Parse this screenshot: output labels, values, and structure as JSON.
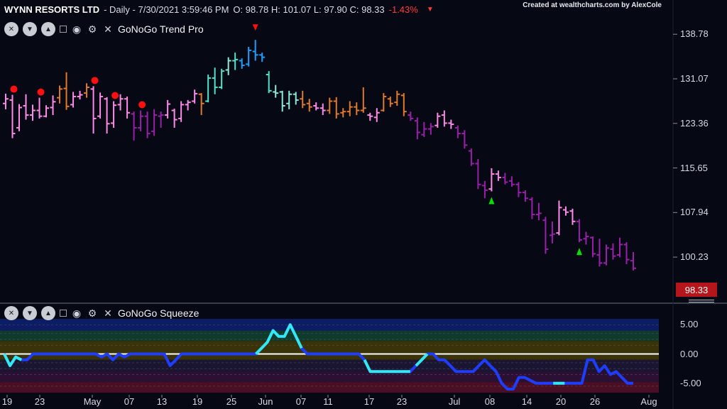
{
  "header": {
    "symbol": "WYNN RESORTS LTD",
    "info": " - Daily - 7/30/2021 3:59:46 PM",
    "ohlc": "O: 98.78 H: 101.07 L: 97.90 C: 98.33",
    "change": "-1.43%",
    "change_icon": "triangle-down-icon"
  },
  "credit": "Created at wealthcharts.com by AlexCole",
  "colors": {
    "background": "#060914",
    "strong_up": "#1e9fff",
    "up": "#4fe3c9",
    "weak_up": "#8fe9d8",
    "neutral": "#e07a2a",
    "weak_down": "#ff8ae6",
    "down": "#9a1faa",
    "strong_down": "#7b0f8a",
    "squeeze_line": "#1e3dff",
    "squeeze_max": "#33e8f0",
    "zero_line": "#ffffff",
    "last_price": "#b5161b",
    "dot": "#ff1010",
    "arrow_up": "#00e000",
    "arrow_down": "#ff1010"
  },
  "panels": {
    "price": {
      "name": "GoNoGo Trend Pro"
    },
    "squeeze": {
      "name": "GoNoGo Squeeze"
    }
  },
  "toolbar_icons": [
    "close-circle-icon",
    "triangle-down-icon",
    "triangle-up-icon",
    "collapse-box-icon",
    "eye-icon",
    "gear-icon",
    "close-icon"
  ],
  "last_price": "98.33",
  "chart_data": [
    {
      "type": "ohlc",
      "title": "WYNN RESORTS LTD",
      "y_ticks": [
        138.78,
        131.07,
        123.36,
        115.65,
        107.94,
        100.23
      ],
      "x_ticks": [
        "19",
        "23",
        "May",
        "07",
        "13",
        "19",
        "25",
        "Jun",
        "07",
        "11",
        "17",
        "23",
        "Jul",
        "08",
        "14",
        "20",
        "26",
        "Aug"
      ],
      "y_range": [
        92.5,
        142
      ],
      "bars": [
        {
          "o": 126.8,
          "h": 128.5,
          "l": 125.8,
          "c": 127.6,
          "s": "weak_down"
        },
        {
          "o": 127.4,
          "h": 128.3,
          "l": 120.8,
          "c": 121.6,
          "s": "weak_down"
        },
        {
          "o": 122.6,
          "h": 126.7,
          "l": 122.0,
          "c": 126.1,
          "s": "weak_down"
        },
        {
          "o": 126.4,
          "h": 128.4,
          "l": 124.0,
          "c": 124.8,
          "s": "weak_down"
        },
        {
          "o": 124.8,
          "h": 126.6,
          "l": 123.8,
          "c": 125.6,
          "s": "weak_down"
        },
        {
          "o": 125.6,
          "h": 127.8,
          "l": 124.2,
          "c": 124.6,
          "s": "weak_down"
        },
        {
          "o": 124.6,
          "h": 126.5,
          "l": 124.4,
          "c": 126.0,
          "s": "weak_down"
        },
        {
          "o": 126.1,
          "h": 128.2,
          "l": 124.8,
          "c": 127.1,
          "s": "weak_down"
        },
        {
          "o": 127.8,
          "h": 129.9,
          "l": 126.8,
          "c": 129.3,
          "s": "neutral"
        },
        {
          "o": 129.4,
          "h": 132.2,
          "l": 125.7,
          "c": 126.3,
          "s": "neutral"
        },
        {
          "o": 126.6,
          "h": 128.8,
          "l": 126.1,
          "c": 128.0,
          "s": "weak_down"
        },
        {
          "o": 128.0,
          "h": 129.0,
          "l": 127.5,
          "c": 128.3,
          "s": "weak_down"
        },
        {
          "o": 128.6,
          "h": 130.3,
          "l": 127.8,
          "c": 129.6,
          "s": "neutral"
        },
        {
          "o": 129.3,
          "h": 129.8,
          "l": 121.6,
          "c": 124.2,
          "s": "weak_down"
        },
        {
          "o": 124.6,
          "h": 128.7,
          "l": 124.2,
          "c": 128.0,
          "s": "weak_down"
        },
        {
          "o": 127.6,
          "h": 127.9,
          "l": 121.6,
          "c": 123.3,
          "s": "weak_down"
        },
        {
          "o": 123.4,
          "h": 127.2,
          "l": 122.6,
          "c": 126.5,
          "s": "weak_down"
        },
        {
          "o": 126.6,
          "h": 128.4,
          "l": 125.6,
          "c": 127.6,
          "s": "weak_down"
        },
        {
          "o": 127.6,
          "h": 128.0,
          "l": 124.2,
          "c": 125.2,
          "s": "weak_down"
        },
        {
          "o": 125.0,
          "h": 125.4,
          "l": 120.4,
          "c": 122.6,
          "s": "down"
        },
        {
          "o": 122.6,
          "h": 125.6,
          "l": 122.0,
          "c": 124.6,
          "s": "down"
        },
        {
          "o": 124.6,
          "h": 125.4,
          "l": 120.8,
          "c": 121.6,
          "s": "down"
        },
        {
          "o": 122.0,
          "h": 125.8,
          "l": 121.2,
          "c": 124.8,
          "s": "down"
        },
        {
          "o": 124.6,
          "h": 125.4,
          "l": 122.6,
          "c": 124.8,
          "s": "down"
        },
        {
          "o": 124.8,
          "h": 127.4,
          "l": 124.2,
          "c": 126.7,
          "s": "weak_down"
        },
        {
          "o": 125.6,
          "h": 125.9,
          "l": 122.6,
          "c": 124.0,
          "s": "weak_down"
        },
        {
          "o": 124.2,
          "h": 127.2,
          "l": 123.6,
          "c": 126.6,
          "s": "weak_down"
        },
        {
          "o": 126.6,
          "h": 127.4,
          "l": 125.6,
          "c": 127.0,
          "s": "weak_down"
        },
        {
          "o": 127.2,
          "h": 129.2,
          "l": 126.8,
          "c": 128.5,
          "s": "weak_down"
        },
        {
          "o": 128.4,
          "h": 128.6,
          "l": 124.8,
          "c": 126.8,
          "s": "neutral"
        },
        {
          "o": 127.2,
          "h": 131.8,
          "l": 127.0,
          "c": 131.2,
          "s": "up"
        },
        {
          "o": 131.2,
          "h": 133.0,
          "l": 128.4,
          "c": 129.6,
          "s": "up"
        },
        {
          "o": 129.6,
          "h": 132.8,
          "l": 129.3,
          "c": 132.4,
          "s": "up"
        },
        {
          "o": 132.6,
          "h": 134.8,
          "l": 131.7,
          "c": 134.2,
          "s": "weak_up"
        },
        {
          "o": 134.2,
          "h": 135.6,
          "l": 132.6,
          "c": 134.4,
          "s": "up"
        },
        {
          "o": 134.2,
          "h": 134.6,
          "l": 132.8,
          "c": 133.4,
          "s": "strong_up"
        },
        {
          "o": 133.6,
          "h": 136.6,
          "l": 133.2,
          "c": 136.0,
          "s": "strong_up"
        },
        {
          "o": 135.8,
          "h": 137.8,
          "l": 134.2,
          "c": 135.2,
          "s": "strong_up"
        },
        {
          "o": 135.2,
          "h": 135.6,
          "l": 134.0,
          "c": 134.8,
          "s": "strong_up"
        },
        {
          "o": 131.8,
          "h": 132.4,
          "l": 128.6,
          "c": 129.0,
          "s": "up"
        },
        {
          "o": 128.8,
          "h": 130.0,
          "l": 127.8,
          "c": 128.6,
          "s": "weak_up"
        },
        {
          "o": 128.8,
          "h": 129.0,
          "l": 125.4,
          "c": 126.4,
          "s": "weak_up"
        },
        {
          "o": 126.8,
          "h": 129.0,
          "l": 125.8,
          "c": 128.4,
          "s": "weak_up"
        },
        {
          "o": 128.4,
          "h": 128.8,
          "l": 126.6,
          "c": 127.4,
          "s": "weak_up"
        },
        {
          "o": 127.6,
          "h": 129.0,
          "l": 126.0,
          "c": 126.6,
          "s": "neutral"
        },
        {
          "o": 126.8,
          "h": 127.6,
          "l": 125.4,
          "c": 126.2,
          "s": "neutral"
        },
        {
          "o": 126.4,
          "h": 127.0,
          "l": 125.6,
          "c": 126.0,
          "s": "weak_down"
        },
        {
          "o": 126.0,
          "h": 126.8,
          "l": 124.8,
          "c": 125.6,
          "s": "weak_down"
        },
        {
          "o": 125.6,
          "h": 127.8,
          "l": 125.0,
          "c": 127.2,
          "s": "neutral"
        },
        {
          "o": 127.2,
          "h": 127.9,
          "l": 124.2,
          "c": 125.0,
          "s": "neutral"
        },
        {
          "o": 125.2,
          "h": 126.0,
          "l": 124.4,
          "c": 125.4,
          "s": "neutral"
        },
        {
          "o": 125.4,
          "h": 127.2,
          "l": 124.6,
          "c": 126.2,
          "s": "neutral"
        },
        {
          "o": 126.2,
          "h": 127.0,
          "l": 124.8,
          "c": 125.6,
          "s": "neutral"
        },
        {
          "o": 125.6,
          "h": 129.6,
          "l": 125.2,
          "c": 126.0,
          "s": "neutral"
        },
        {
          "o": 124.8,
          "h": 125.2,
          "l": 123.8,
          "c": 124.6,
          "s": "weak_down"
        },
        {
          "o": 124.4,
          "h": 126.0,
          "l": 123.6,
          "c": 125.2,
          "s": "weak_down"
        },
        {
          "o": 125.6,
          "h": 128.6,
          "l": 125.4,
          "c": 128.0,
          "s": "neutral"
        },
        {
          "o": 127.6,
          "h": 128.0,
          "l": 126.2,
          "c": 126.8,
          "s": "neutral"
        },
        {
          "o": 127.0,
          "h": 129.0,
          "l": 126.4,
          "c": 128.4,
          "s": "neutral"
        },
        {
          "o": 128.2,
          "h": 128.6,
          "l": 124.6,
          "c": 125.4,
          "s": "neutral"
        },
        {
          "o": 124.8,
          "h": 125.4,
          "l": 123.8,
          "c": 124.2,
          "s": "down"
        },
        {
          "o": 123.8,
          "h": 124.4,
          "l": 120.6,
          "c": 121.8,
          "s": "down"
        },
        {
          "o": 121.4,
          "h": 123.6,
          "l": 121.0,
          "c": 122.4,
          "s": "down"
        },
        {
          "o": 122.4,
          "h": 123.4,
          "l": 121.4,
          "c": 122.8,
          "s": "down"
        },
        {
          "o": 123.0,
          "h": 125.2,
          "l": 122.6,
          "c": 124.6,
          "s": "weak_down"
        },
        {
          "o": 124.8,
          "h": 125.6,
          "l": 122.8,
          "c": 123.4,
          "s": "weak_down"
        },
        {
          "o": 123.4,
          "h": 124.0,
          "l": 122.4,
          "c": 123.2,
          "s": "weak_down"
        },
        {
          "o": 122.6,
          "h": 123.0,
          "l": 120.8,
          "c": 121.6,
          "s": "down"
        },
        {
          "o": 121.6,
          "h": 122.2,
          "l": 119.0,
          "c": 119.6,
          "s": "down"
        },
        {
          "o": 118.6,
          "h": 119.0,
          "l": 116.0,
          "c": 116.4,
          "s": "down"
        },
        {
          "o": 116.4,
          "h": 117.2,
          "l": 112.0,
          "c": 112.8,
          "s": "down"
        },
        {
          "o": 112.6,
          "h": 113.4,
          "l": 110.4,
          "c": 111.8,
          "s": "down"
        },
        {
          "o": 112.0,
          "h": 115.6,
          "l": 111.6,
          "c": 114.6,
          "s": "weak_down"
        },
        {
          "o": 114.6,
          "h": 115.2,
          "l": 113.4,
          "c": 114.0,
          "s": "weak_down"
        },
        {
          "o": 114.0,
          "h": 114.8,
          "l": 112.8,
          "c": 113.2,
          "s": "down"
        },
        {
          "o": 113.4,
          "h": 114.2,
          "l": 112.4,
          "c": 112.8,
          "s": "down"
        },
        {
          "o": 112.8,
          "h": 113.2,
          "l": 110.6,
          "c": 111.4,
          "s": "down"
        },
        {
          "o": 111.4,
          "h": 111.8,
          "l": 109.8,
          "c": 110.4,
          "s": "down"
        },
        {
          "o": 110.2,
          "h": 110.6,
          "l": 106.8,
          "c": 107.6,
          "s": "down"
        },
        {
          "o": 107.6,
          "h": 109.6,
          "l": 106.6,
          "c": 107.8,
          "s": "down"
        },
        {
          "o": 106.6,
          "h": 107.2,
          "l": 100.8,
          "c": 101.6,
          "s": "down"
        },
        {
          "o": 104.0,
          "h": 106.4,
          "l": 102.6,
          "c": 104.2,
          "s": "down"
        },
        {
          "o": 104.4,
          "h": 110.0,
          "l": 104.0,
          "c": 108.8,
          "s": "weak_down"
        },
        {
          "o": 108.4,
          "h": 109.0,
          "l": 107.4,
          "c": 108.0,
          "s": "weak_down"
        },
        {
          "o": 108.2,
          "h": 108.6,
          "l": 105.8,
          "c": 106.4,
          "s": "weak_down"
        },
        {
          "o": 106.4,
          "h": 106.8,
          "l": 102.8,
          "c": 103.2,
          "s": "down"
        },
        {
          "o": 103.4,
          "h": 104.6,
          "l": 102.4,
          "c": 103.8,
          "s": "down"
        },
        {
          "o": 103.6,
          "h": 103.8,
          "l": 100.2,
          "c": 100.8,
          "s": "down"
        },
        {
          "o": 100.6,
          "h": 103.4,
          "l": 98.6,
          "c": 99.2,
          "s": "down"
        },
        {
          "o": 99.2,
          "h": 102.4,
          "l": 98.8,
          "c": 101.8,
          "s": "down"
        },
        {
          "o": 101.6,
          "h": 102.6,
          "l": 99.8,
          "c": 100.4,
          "s": "down"
        },
        {
          "o": 100.6,
          "h": 103.6,
          "l": 100.2,
          "c": 102.4,
          "s": "down"
        },
        {
          "o": 102.4,
          "h": 102.8,
          "l": 99.0,
          "c": 99.8,
          "s": "down"
        },
        {
          "o": 99.6,
          "h": 101.1,
          "l": 97.9,
          "c": 98.3,
          "s": "down"
        }
      ],
      "red_dot_bars": [
        1,
        5,
        13,
        16,
        20
      ],
      "arrow_down_bars": [
        37
      ],
      "arrow_up_bars": [
        72,
        85
      ]
    },
    {
      "type": "line",
      "title": "GoNoGo Squeeze",
      "y_ticks": [
        5.0,
        0.0,
        -5.0
      ],
      "y_tick_labels": [
        "5.00",
        "0.00",
        "-5.00"
      ],
      "y_range": [
        -6.6,
        6.0
      ],
      "values": [
        0,
        -2,
        -0.5,
        -1,
        -1,
        0,
        0,
        0,
        0,
        0,
        0,
        0,
        0,
        0,
        0,
        0,
        0,
        -0.5,
        0,
        -1,
        0,
        -0.5,
        0,
        0,
        0,
        0,
        0,
        0,
        0,
        -2,
        -1,
        0,
        0,
        0,
        0,
        0,
        0,
        0,
        0,
        0,
        0,
        0,
        0,
        0,
        0,
        1,
        2,
        4,
        3,
        3,
        5,
        3,
        1,
        0,
        0,
        0,
        0,
        0,
        0,
        0,
        0,
        0,
        0,
        -1,
        -3,
        -3,
        -3,
        -3,
        -3,
        -3,
        -3,
        -3,
        -2,
        -1,
        0,
        0,
        -1,
        -1,
        -2,
        -3,
        -3,
        -3,
        -3,
        -2,
        -1,
        -2,
        -3,
        -5,
        -6,
        -6,
        -4,
        -4,
        -4.5,
        -5,
        -5,
        -5,
        -5,
        -5,
        -5,
        -5,
        -5,
        -5,
        -1,
        -1,
        -3,
        -2,
        -3.5,
        -3,
        -4,
        -5,
        -5
      ],
      "max_squeeze_ranges": [
        [
          0,
          3
        ],
        [
          44,
          52
        ],
        [
          63,
          71
        ],
        [
          72,
          74
        ],
        [
          96,
          98
        ]
      ]
    }
  ]
}
